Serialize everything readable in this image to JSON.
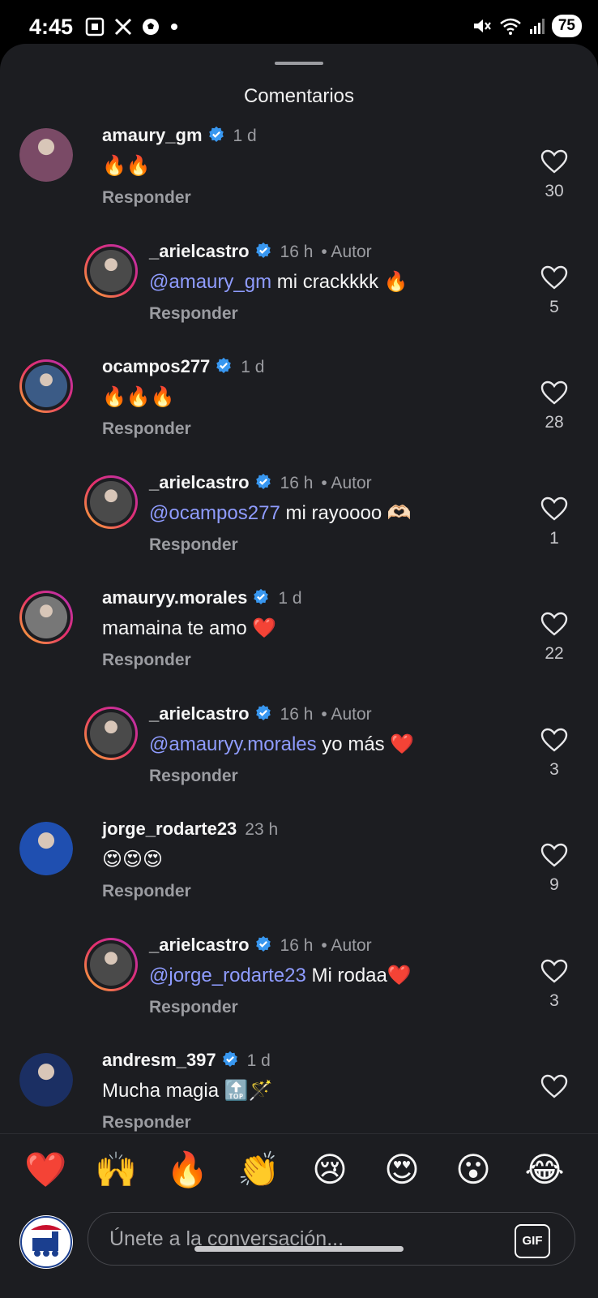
{
  "status_bar": {
    "time": "4:45",
    "left_icons": [
      "screenshot-icon",
      "x-icon",
      "soccer-ball-icon",
      "dot-icon"
    ],
    "right_icons": [
      "mute-icon",
      "wifi-icon",
      "signal-icon"
    ],
    "battery": "75"
  },
  "sheet": {
    "title": "Comentarios"
  },
  "reply_label": "Responder",
  "comments": [
    {
      "username": "amaury_gm",
      "verified": true,
      "time": "1 d",
      "author": "",
      "mention": "",
      "text": "🔥🔥",
      "likes": "30",
      "reply": false,
      "avatar_color": "#7a4a66"
    },
    {
      "username": "_arielcastro",
      "verified": true,
      "time": "16 h",
      "author": "• Autor",
      "mention": "@amaury_gm",
      "text": " mi crackkkk 🔥",
      "likes": "5",
      "reply": true,
      "avatar_color": "#4a4a4a"
    },
    {
      "username": "ocampos277",
      "verified": true,
      "time": "1 d",
      "author": "",
      "mention": "",
      "text": "🔥🔥🔥",
      "likes": "28",
      "reply": false,
      "avatar_color": "#3b5b86"
    },
    {
      "username": "_arielcastro",
      "verified": true,
      "time": "16 h",
      "author": "• Autor",
      "mention": "@ocampos277",
      "text": " mi rayoooo 🫶🏻",
      "likes": "1",
      "reply": true,
      "avatar_color": "#4a4a4a"
    },
    {
      "username": "amauryy.morales",
      "verified": true,
      "time": "1 d",
      "author": "",
      "mention": "",
      "text": "mamaina te amo ❤️",
      "likes": "22",
      "reply": false,
      "avatar_color": "#777777"
    },
    {
      "username": "_arielcastro",
      "verified": true,
      "time": "16 h",
      "author": "• Autor",
      "mention": "@amauryy.morales",
      "text": " yo más ❤️",
      "likes": "3",
      "reply": true,
      "avatar_color": "#4a4a4a"
    },
    {
      "username": "jorge_rodarte23",
      "verified": false,
      "time": "23 h",
      "author": "",
      "mention": "",
      "text": "😍😍😍",
      "likes": "9",
      "reply": false,
      "avatar_color": "#1f4fb0"
    },
    {
      "username": "_arielcastro",
      "verified": true,
      "time": "16 h",
      "author": "• Autor",
      "mention": "@jorge_rodarte23",
      "text": " Mi rodaa❤️",
      "likes": "3",
      "reply": true,
      "avatar_color": "#4a4a4a"
    },
    {
      "username": "andresm_397",
      "verified": true,
      "time": "1 d",
      "author": "",
      "mention": "",
      "text": "Mucha magia 🔝🪄",
      "likes": "",
      "reply": false,
      "avatar_color": "#1b2f63"
    }
  ],
  "emoji_bar": [
    "❤️",
    "🙌",
    "🔥",
    "👏",
    "😢",
    "😍",
    "😮",
    "😂"
  ],
  "input": {
    "placeholder": "Únete a la conversación...",
    "gif_label": "GIF"
  },
  "colors": {
    "background": "#1c1d21",
    "mention": "#8f9cff",
    "verified": "#3897f0"
  }
}
